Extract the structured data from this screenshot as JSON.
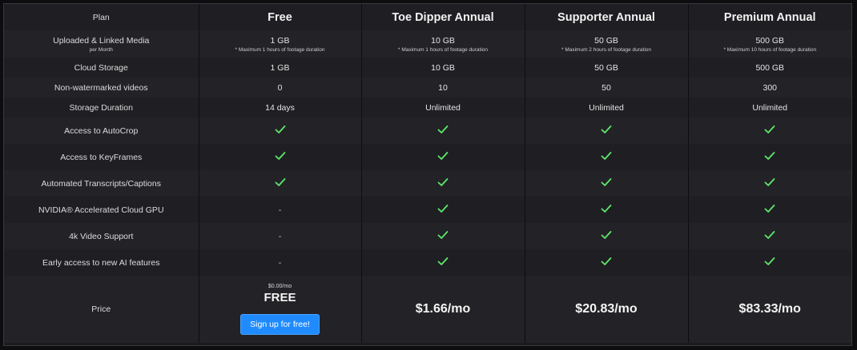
{
  "header": {
    "label": "Plan",
    "plans": [
      "Free",
      "Toe Dipper Annual",
      "Supporter Annual",
      "Premium Annual"
    ]
  },
  "rows": [
    {
      "label": "Uploaded & Linked Media",
      "sublabel": "per Month",
      "cells": [
        {
          "value": "1 GB",
          "note": "* Maximum 1 hours of footage duration"
        },
        {
          "value": "10 GB",
          "note": "* Maximum 1 hours of footage duration"
        },
        {
          "value": "50 GB",
          "note": "* Maximum 2 hours of footage duration"
        },
        {
          "value": "500 GB",
          "note": "* Maximum 10 hours of footage duration"
        }
      ]
    },
    {
      "label": "Cloud Storage",
      "cells": [
        "1 GB",
        "10 GB",
        "50 GB",
        "500 GB"
      ]
    },
    {
      "label": "Non-watermarked videos",
      "cells": [
        "0",
        "10",
        "50",
        "300"
      ]
    },
    {
      "label": "Storage Duration",
      "cells": [
        "14 days",
        "Unlimited",
        "Unlimited",
        "Unlimited"
      ]
    },
    {
      "label": "Access to AutoCrop",
      "cells": [
        "check",
        "check",
        "check",
        "check"
      ]
    },
    {
      "label": "Access to KeyFrames",
      "cells": [
        "check",
        "check",
        "check",
        "check"
      ]
    },
    {
      "label": "Automated Transcripts/Captions",
      "cells": [
        "check",
        "check",
        "check",
        "check"
      ]
    },
    {
      "label": "NVIDIA® Accelerated Cloud GPU",
      "cells": [
        "-",
        "check",
        "check",
        "check"
      ]
    },
    {
      "label": "4k Video Support",
      "cells": [
        "-",
        "check",
        "check",
        "check"
      ]
    },
    {
      "label": "Early access to new AI features",
      "cells": [
        "-",
        "check",
        "check",
        "check"
      ]
    }
  ],
  "price": {
    "label": "Price",
    "free_small": "$0.00/mo",
    "free_big": "FREE",
    "signup_button": "Sign up for free!",
    "toe_dipper": "$1.66/mo",
    "supporter": "$20.83/mo",
    "premium": "$83.33/mo"
  },
  "colors": {
    "check": "#5ee86a",
    "button": "#1f8bff"
  },
  "icons": {
    "check": "check-icon"
  }
}
